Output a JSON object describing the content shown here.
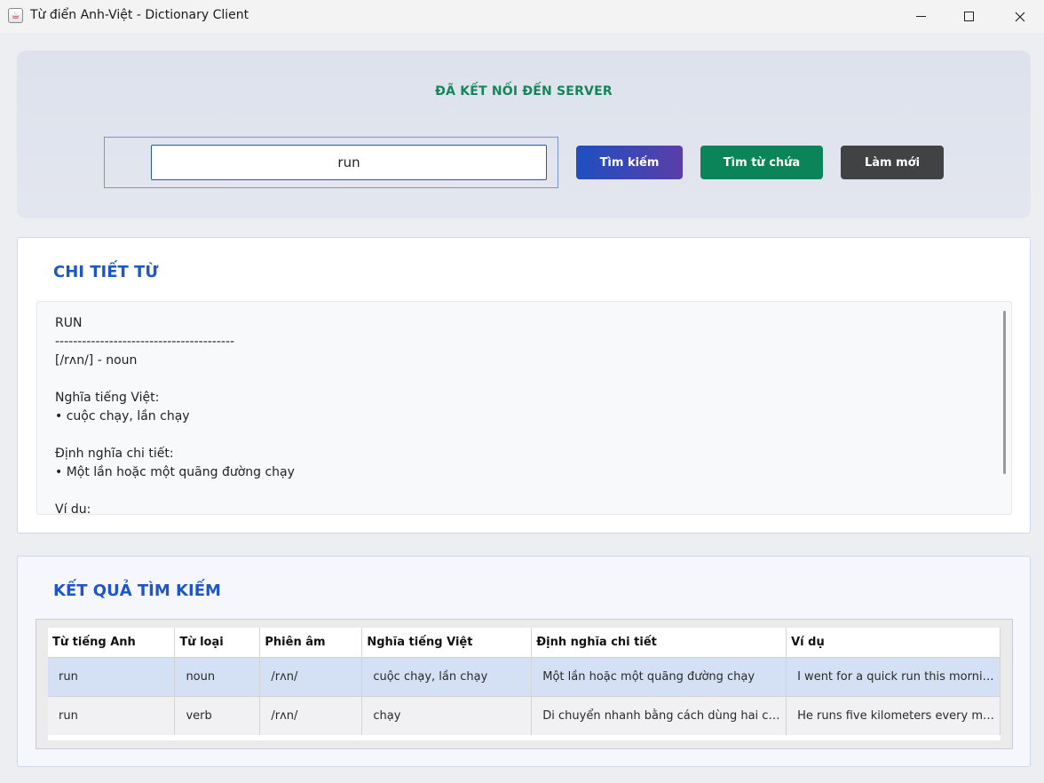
{
  "window": {
    "title": "Từ điển Anh-Việt - Dictionary Client",
    "app_icon": "java-icon",
    "controls": [
      "minimize-icon",
      "maximize-icon",
      "close-icon"
    ]
  },
  "header": {
    "status": "ĐÃ KẾT NỐI ĐẾN SERVER",
    "status_color": "#13875a"
  },
  "search": {
    "value": "run",
    "buttons": {
      "search": "Tìm kiếm",
      "contains": "Tìm từ chứa",
      "refresh": "Làm mới"
    }
  },
  "detail": {
    "title": "CHI TIẾT TỪ",
    "text": "RUN\n----------------------------------------\n[/rʌn/] - noun\n\nNghĩa tiếng Việt:\n• cuộc chạy, lần chạy\n\nĐịnh nghĩa chi tiết:\n• Một lần hoặc một quãng đường chạy\n\nVí dụ:"
  },
  "results": {
    "title": "KẾT QUẢ TÌM KIẾM",
    "columns": [
      "Từ tiếng Anh",
      "Từ loại",
      "Phiên âm",
      "Nghĩa tiếng Việt",
      "Định nghĩa chi tiết",
      "Ví dụ"
    ],
    "rows": [
      [
        "run",
        "noun",
        "/rʌn/",
        "cuộc chạy, lần chạy",
        "Một lần hoặc một quãng đường chạy",
        "I went for a quick run this morning."
      ],
      [
        "run",
        "verb",
        "/rʌn/",
        "chạy",
        "Di chuyển nhanh bằng cách dùng hai chân",
        "He runs five kilometers every morning."
      ]
    ],
    "selected_row": 0
  },
  "colors": {
    "accent_title": "#1e55c7",
    "search_button": "#1f4fc0",
    "contains_button": "#0b8459",
    "refresh_button": "#414244"
  }
}
